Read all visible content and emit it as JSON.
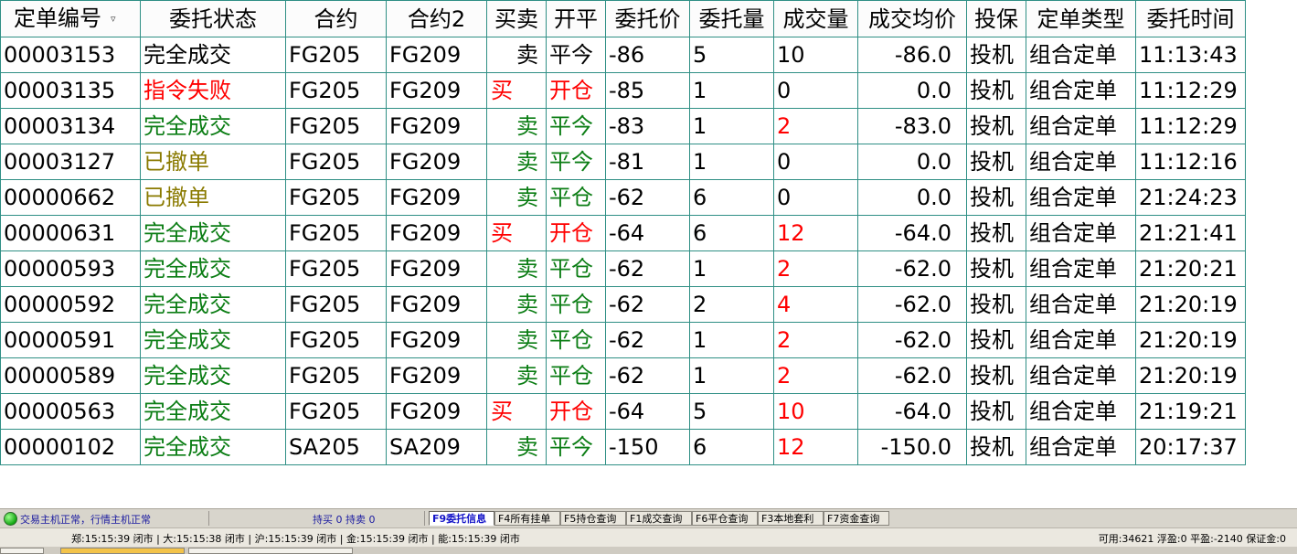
{
  "columns": [
    "定单编号",
    "委托状态",
    "合约",
    "合约2",
    "买卖",
    "开平",
    "委托价",
    "委托量",
    "成交量",
    "成交均价",
    "投保",
    "定单类型",
    "委托时间"
  ],
  "sort_indicator": "▿",
  "colors": {
    "complete": "#0b7d14",
    "failed": "#ff0000",
    "cancelled": "#8a7a00",
    "buy": "#ff0000",
    "sell": "#0b7d14",
    "traded_highlight": "#ff0000",
    "grid_border": "#2f8f85"
  },
  "rows": [
    {
      "id": "00003153",
      "status": "完全成交",
      "status_type": "complete",
      "c1": "FG205",
      "c2": "FG209",
      "side": "卖",
      "side_type": "sell",
      "offset": "平今",
      "price": "-86",
      "qty": "5",
      "traded": "10",
      "traded_hl": false,
      "avg": "-86.0",
      "hedge": "投机",
      "otype": "组合定单",
      "time": "11:13:43",
      "plain": true
    },
    {
      "id": "00003135",
      "status": "指令失败",
      "status_type": "failed",
      "c1": "FG205",
      "c2": "FG209",
      "side": "买",
      "side_type": "buy",
      "offset": "开仓",
      "price": "-85",
      "qty": "1",
      "traded": "0",
      "traded_hl": false,
      "avg": "0.0",
      "hedge": "投机",
      "otype": "组合定单",
      "time": "11:12:29",
      "plain": false
    },
    {
      "id": "00003134",
      "status": "完全成交",
      "status_type": "complete",
      "c1": "FG205",
      "c2": "FG209",
      "side": "卖",
      "side_type": "sell",
      "offset": "平今",
      "price": "-83",
      "qty": "1",
      "traded": "2",
      "traded_hl": true,
      "avg": "-83.0",
      "hedge": "投机",
      "otype": "组合定单",
      "time": "11:12:29",
      "plain": false
    },
    {
      "id": "00003127",
      "status": "已撤单",
      "status_type": "cancelled",
      "c1": "FG205",
      "c2": "FG209",
      "side": "卖",
      "side_type": "sell",
      "offset": "平今",
      "price": "-81",
      "qty": "1",
      "traded": "0",
      "traded_hl": false,
      "avg": "0.0",
      "hedge": "投机",
      "otype": "组合定单",
      "time": "11:12:16",
      "plain": false
    },
    {
      "id": "00000662",
      "status": "已撤单",
      "status_type": "cancelled",
      "c1": "FG205",
      "c2": "FG209",
      "side": "卖",
      "side_type": "sell",
      "offset": "平仓",
      "price": "-62",
      "qty": "6",
      "traded": "0",
      "traded_hl": false,
      "avg": "0.0",
      "hedge": "投机",
      "otype": "组合定单",
      "time": "21:24:23",
      "plain": false
    },
    {
      "id": "00000631",
      "status": "完全成交",
      "status_type": "complete",
      "c1": "FG205",
      "c2": "FG209",
      "side": "买",
      "side_type": "buy",
      "offset": "开仓",
      "price": "-64",
      "qty": "6",
      "traded": "12",
      "traded_hl": true,
      "avg": "-64.0",
      "hedge": "投机",
      "otype": "组合定单",
      "time": "21:21:41",
      "plain": false
    },
    {
      "id": "00000593",
      "status": "完全成交",
      "status_type": "complete",
      "c1": "FG205",
      "c2": "FG209",
      "side": "卖",
      "side_type": "sell",
      "offset": "平仓",
      "price": "-62",
      "qty": "1",
      "traded": "2",
      "traded_hl": true,
      "avg": "-62.0",
      "hedge": "投机",
      "otype": "组合定单",
      "time": "21:20:21",
      "plain": false
    },
    {
      "id": "00000592",
      "status": "完全成交",
      "status_type": "complete",
      "c1": "FG205",
      "c2": "FG209",
      "side": "卖",
      "side_type": "sell",
      "offset": "平仓",
      "price": "-62",
      "qty": "2",
      "traded": "4",
      "traded_hl": true,
      "avg": "-62.0",
      "hedge": "投机",
      "otype": "组合定单",
      "time": "21:20:19",
      "plain": false
    },
    {
      "id": "00000591",
      "status": "完全成交",
      "status_type": "complete",
      "c1": "FG205",
      "c2": "FG209",
      "side": "卖",
      "side_type": "sell",
      "offset": "平仓",
      "price": "-62",
      "qty": "1",
      "traded": "2",
      "traded_hl": true,
      "avg": "-62.0",
      "hedge": "投机",
      "otype": "组合定单",
      "time": "21:20:19",
      "plain": false
    },
    {
      "id": "00000589",
      "status": "完全成交",
      "status_type": "complete",
      "c1": "FG205",
      "c2": "FG209",
      "side": "卖",
      "side_type": "sell",
      "offset": "平仓",
      "price": "-62",
      "qty": "1",
      "traded": "2",
      "traded_hl": true,
      "avg": "-62.0",
      "hedge": "投机",
      "otype": "组合定单",
      "time": "21:20:19",
      "plain": false
    },
    {
      "id": "00000563",
      "status": "完全成交",
      "status_type": "complete",
      "c1": "FG205",
      "c2": "FG209",
      "side": "买",
      "side_type": "buy",
      "offset": "开仓",
      "price": "-64",
      "qty": "5",
      "traded": "10",
      "traded_hl": true,
      "avg": "-64.0",
      "hedge": "投机",
      "otype": "组合定单",
      "time": "21:19:21",
      "plain": false
    },
    {
      "id": "00000102",
      "status": "完全成交",
      "status_type": "complete",
      "c1": "SA205",
      "c2": "SA209",
      "side": "卖",
      "side_type": "sell",
      "offset": "平今",
      "price": "-150",
      "qty": "6",
      "traded": "12",
      "traded_hl": true,
      "avg": "-150.0",
      "hedge": "投机",
      "otype": "组合定单",
      "time": "20:17:37",
      "plain": false
    }
  ],
  "status_bar": {
    "light_icon": "status-green-light-icon",
    "text": "交易主机正常，行情主机正常",
    "hold_info": "持买 0  持卖 0",
    "tabs": [
      {
        "label": "F9委托信息",
        "active": true
      },
      {
        "label": "F4所有挂单",
        "active": false
      },
      {
        "label": "F5持仓查询",
        "active": false
      },
      {
        "label": "F1成交查询",
        "active": false
      },
      {
        "label": "F6平仓查询",
        "active": false
      },
      {
        "label": "F3本地套利",
        "active": false
      },
      {
        "label": "F7资金查询",
        "active": false
      }
    ]
  },
  "info_bar": {
    "market_times": "郑:15:15:39 闭市 | 大:15:15:38 闭市 | 沪:15:15:39 闭市 | 金:15:15:39 闭市 | 能:15:15:39 闭市",
    "account": "可用:34621 浮盈:0 平盈:-2140 保证金:0"
  }
}
